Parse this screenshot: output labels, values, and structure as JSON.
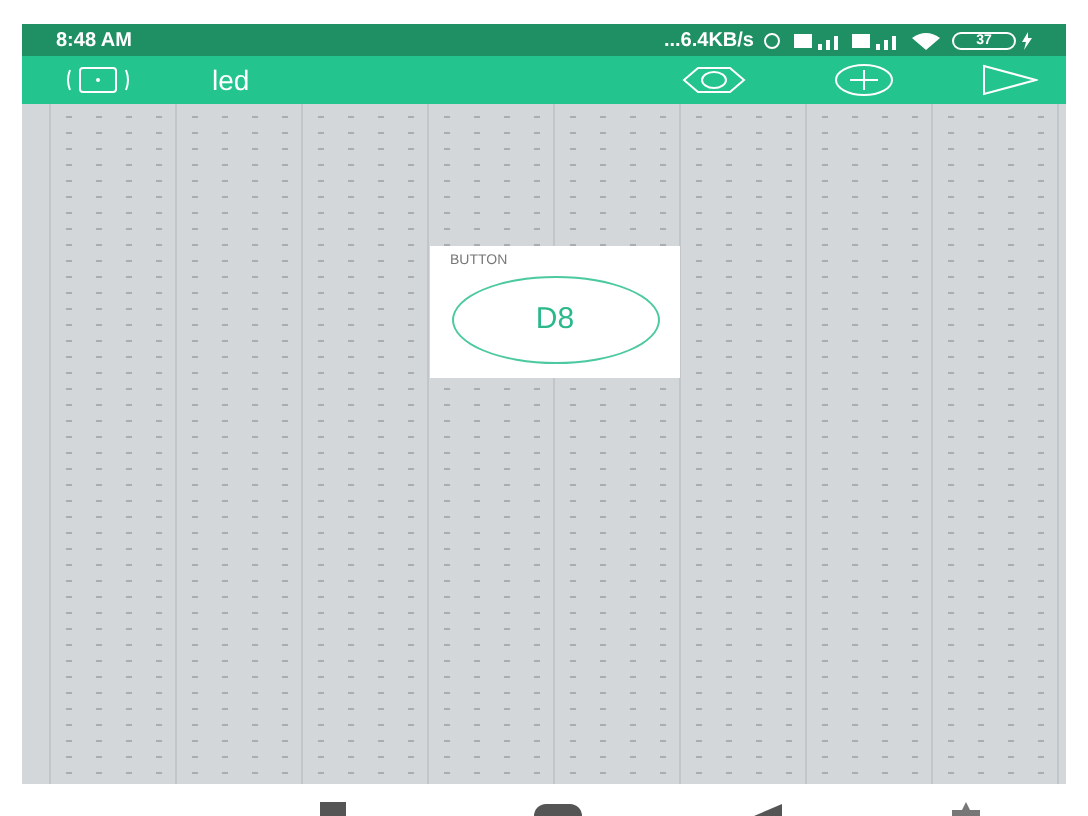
{
  "status_bar": {
    "time": "8:48 AM",
    "network_speed": "...6.4KB/s",
    "battery": "37"
  },
  "app_bar": {
    "title": "led"
  },
  "widgets": [
    {
      "kind": "button",
      "label": "BUTTON",
      "pin": "D8"
    }
  ]
}
